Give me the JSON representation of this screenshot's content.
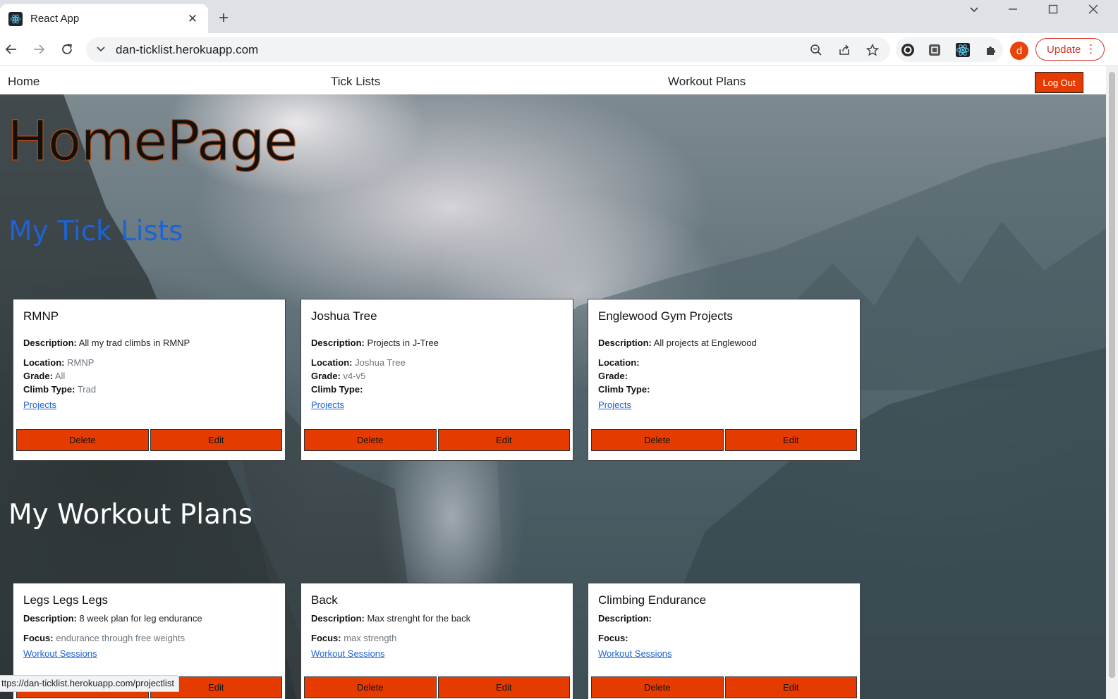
{
  "browser": {
    "tab_title": "React App",
    "url": "dan-ticklist.herokuapp.com",
    "avatar_letter": "d",
    "update_label": "Update",
    "status_url": "ttps://dan-ticklist.herokuapp.com/projectlist"
  },
  "nav": {
    "home": "Home",
    "tick_lists": "Tick Lists",
    "workout_plans": "Workout Plans",
    "logout": "Log Out"
  },
  "page": {
    "title": "HomePage",
    "tick_section_title": "My Tick Lists",
    "workout_section_title": "My Workout Plans"
  },
  "labels": {
    "description": "Description:",
    "location": "Location:",
    "grade": "Grade:",
    "climb_type": "Climb Type:",
    "focus": "Focus:",
    "delete": "Delete",
    "edit": "Edit",
    "projects_link": "Projects",
    "sessions_link": "Workout Sessions"
  },
  "tick_lists": [
    {
      "name": "RMNP",
      "description": "All my trad climbs in RMNP",
      "location": "RMNP",
      "grade": "All",
      "climb_type": "Trad"
    },
    {
      "name": "Joshua Tree",
      "description": "Projects in J-Tree",
      "location": "Joshua Tree",
      "grade": "v4-v5",
      "climb_type": ""
    },
    {
      "name": "Englewood Gym Projects",
      "description": "All projects at Englewood",
      "location": "",
      "grade": "",
      "climb_type": ""
    }
  ],
  "workout_plans": [
    {
      "name": "Legs Legs Legs",
      "description": "8 week plan for leg endurance",
      "focus": "endurance through free weights"
    },
    {
      "name": "Back",
      "description": "Max strenght for the back",
      "focus": "max strength"
    },
    {
      "name": "Climbing Endurance",
      "description": "",
      "focus": ""
    }
  ],
  "colors": {
    "button_orange": "#e63b00",
    "tick_title_blue": "#1e63d6",
    "link_blue": "#1e63d6"
  }
}
